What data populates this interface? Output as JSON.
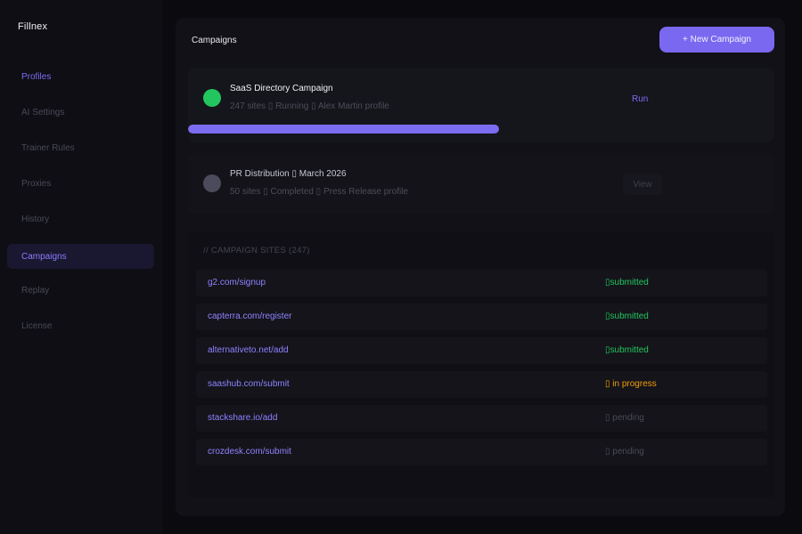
{
  "app": {
    "name": "Fillnex"
  },
  "sidebar": {
    "items": [
      {
        "label": "Profiles",
        "state": "highlight"
      },
      {
        "label": "AI Settings",
        "state": "normal"
      },
      {
        "label": "Trainer Rules",
        "state": "normal"
      },
      {
        "label": "Proxies",
        "state": "normal"
      },
      {
        "label": "History",
        "state": "normal"
      },
      {
        "label": "Campaigns",
        "state": "active"
      },
      {
        "label": "Replay",
        "state": "normal"
      },
      {
        "label": "License",
        "state": "normal"
      }
    ]
  },
  "header": {
    "title": "Campaigns",
    "new_button_label": "+ New Campaign"
  },
  "campaigns": [
    {
      "name": "SaaS Directory Campaign",
      "meta": "247 sites ▯ Running ▯ Alex Martin profile",
      "action_label": "Run",
      "status_color": "#22c55e",
      "progress": 0.53
    },
    {
      "name": "PR Distribution ▯ March 2026",
      "meta": "50 sites ▯ Completed ▯ Press Release profile",
      "action_label": "View",
      "status_color": "#4b4b5c"
    }
  ],
  "sites": {
    "header": "// CAMPAIGN SITES (247)",
    "rows": [
      {
        "url": "g2.com/signup",
        "status": "▯submitted",
        "kind": "submitted"
      },
      {
        "url": "capterra.com/register",
        "status": "▯submitted",
        "kind": "submitted"
      },
      {
        "url": "alternativeto.net/add",
        "status": "▯submitted",
        "kind": "submitted"
      },
      {
        "url": "saashub.com/submit",
        "status": "▯ in progress",
        "kind": "progress"
      },
      {
        "url": "stackshare.io/add",
        "status": "▯ pending",
        "kind": "pending"
      },
      {
        "url": "crozdesk.com/submit",
        "status": "▯ pending",
        "kind": "pending"
      }
    ]
  },
  "colors": {
    "accent": "#7c6cf0",
    "success": "#22c55e",
    "warning": "#f59e0b",
    "background": "#0a0a0f"
  }
}
